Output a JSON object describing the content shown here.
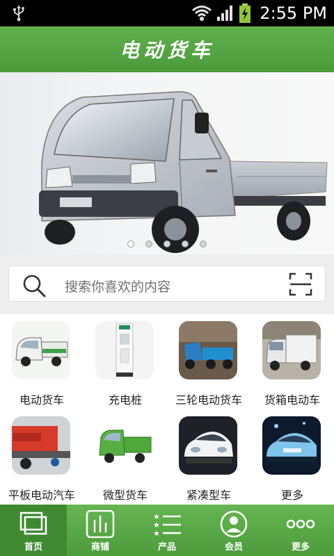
{
  "status_bar": {
    "time": "2:55 PM",
    "icons": [
      "usb-icon",
      "wifi-icon",
      "signal-icon",
      "battery-charging-icon"
    ]
  },
  "header": {
    "title": "电动货车"
  },
  "banner": {
    "page_count": 5,
    "active_index": 0
  },
  "search": {
    "placeholder": "搜索你喜欢的内容"
  },
  "categories": [
    {
      "label": "电动货车"
    },
    {
      "label": "充电桩"
    },
    {
      "label": "三轮电动货车"
    },
    {
      "label": "货箱电动车"
    },
    {
      "label": "平板电动汽车"
    },
    {
      "label": "微型货车"
    },
    {
      "label": "紧凑型车"
    },
    {
      "label": "更多"
    }
  ],
  "tabs": [
    {
      "label": "首页",
      "icon": "home-windows-icon",
      "active": true
    },
    {
      "label": "商铺",
      "icon": "store-chart-icon",
      "active": false
    },
    {
      "label": "产品",
      "icon": "product-list-icon",
      "active": false
    },
    {
      "label": "会员",
      "icon": "member-person-icon",
      "active": false
    },
    {
      "label": "更多",
      "icon": "more-dots-icon",
      "active": false
    }
  ]
}
